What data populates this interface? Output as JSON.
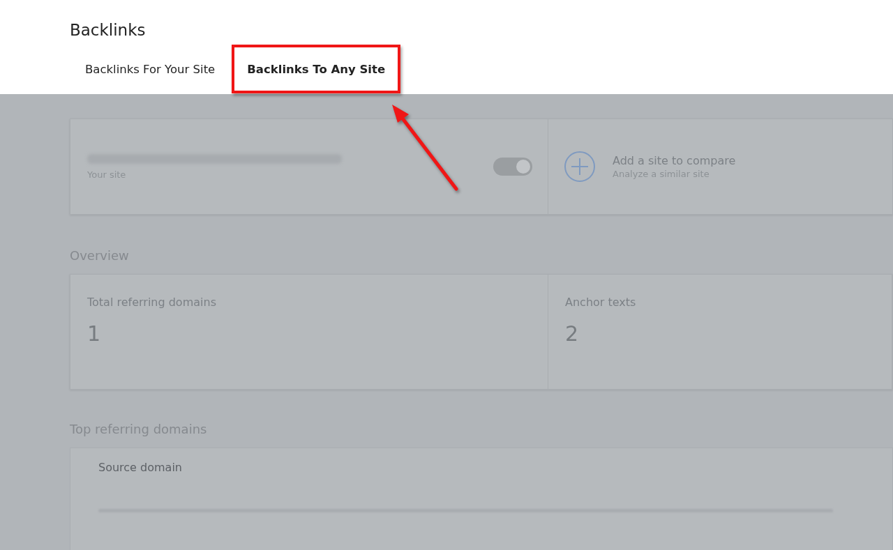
{
  "page": {
    "title": "Backlinks"
  },
  "tabs": [
    {
      "label": "Backlinks For Your Site",
      "selected": false,
      "highlighted": false
    },
    {
      "label": "Backlinks To Any Site",
      "selected": true,
      "highlighted": true
    }
  ],
  "site_card": {
    "caption": "Your site",
    "toggle_on": true,
    "compare_title": "Add a site to compare",
    "compare_subtitle": "Analyze a similar site"
  },
  "overview": {
    "heading": "Overview",
    "metrics": [
      {
        "label": "Total referring domains",
        "value": "1"
      },
      {
        "label": "Anchor texts",
        "value": "2"
      }
    ]
  },
  "top_referring_domains": {
    "heading": "Top referring domains",
    "columns": [
      "Source domain"
    ]
  }
}
